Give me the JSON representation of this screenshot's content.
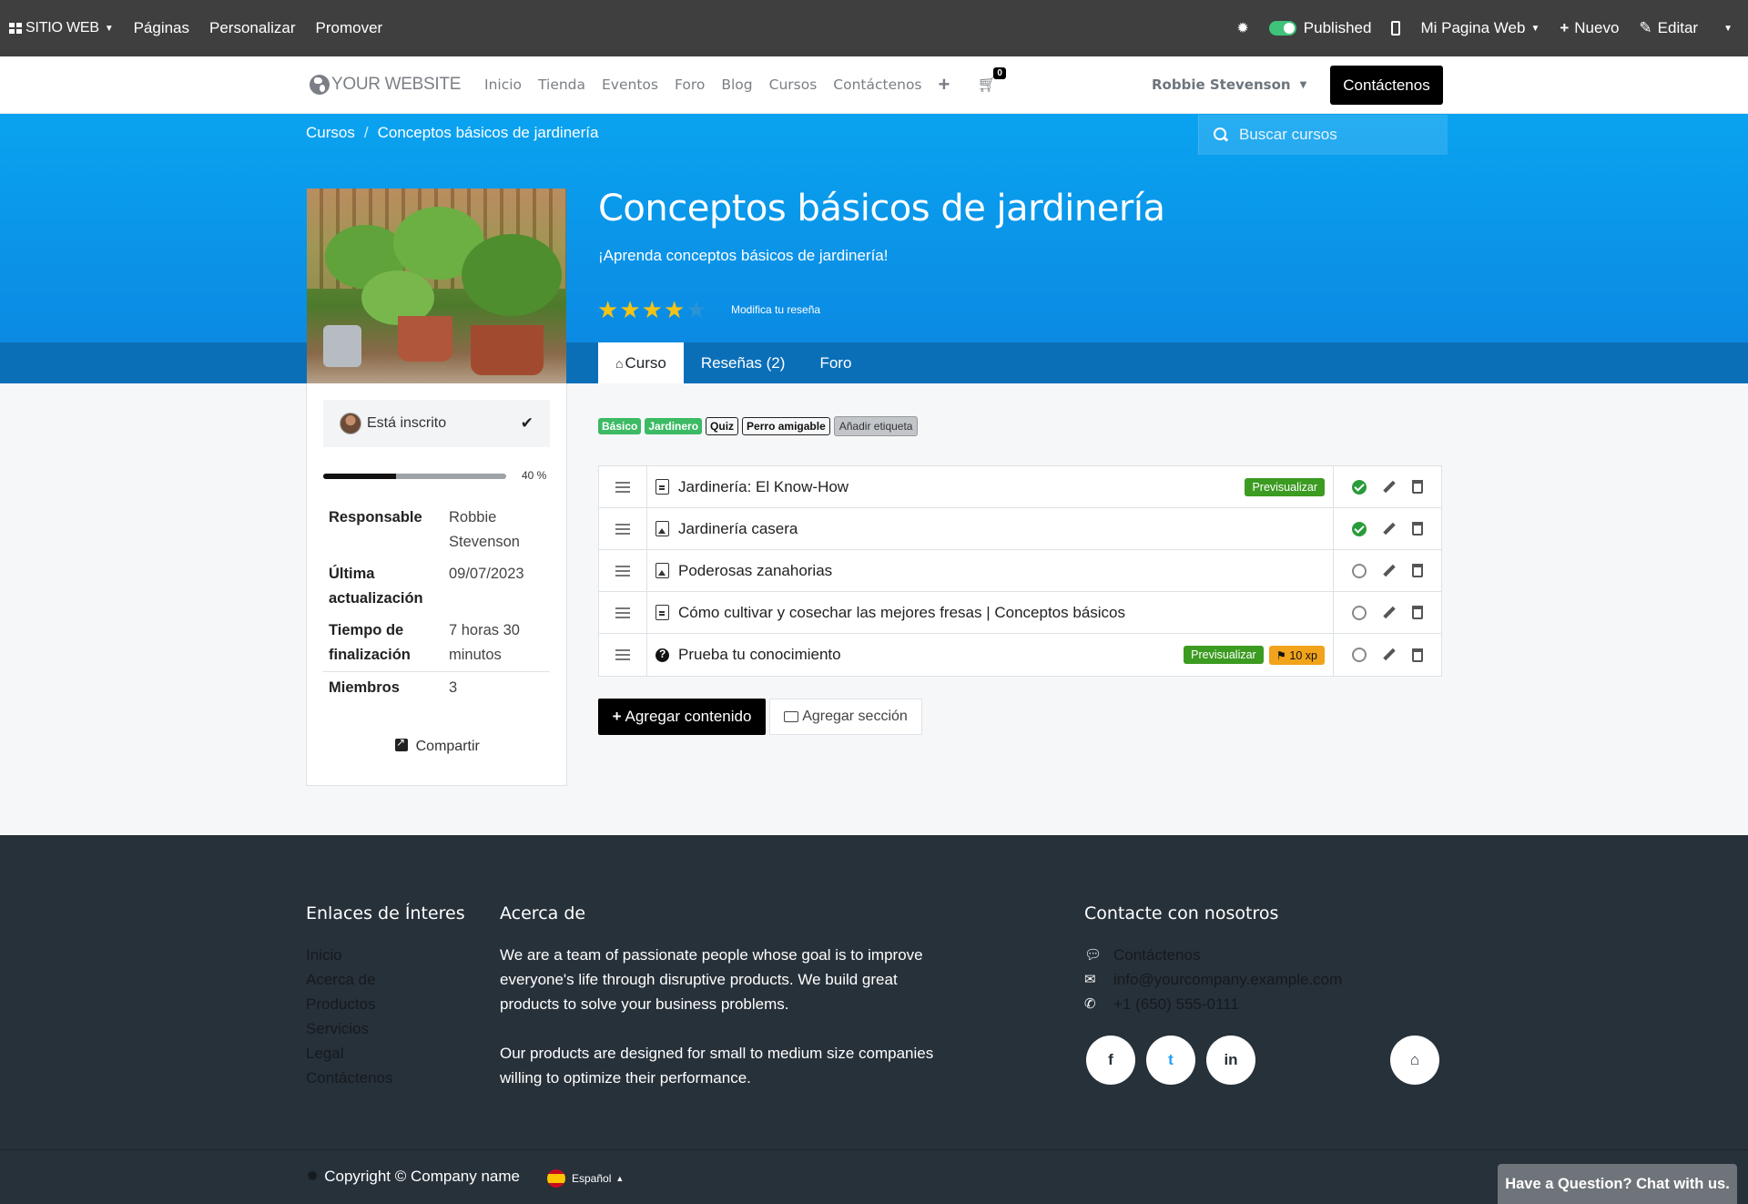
{
  "admin": {
    "brand": "SITIO WEB",
    "menu": [
      "Páginas",
      "Personalizar",
      "Promover"
    ],
    "published_label": "Published",
    "site_selector": "Mi Pagina Web",
    "new_label": "Nuevo",
    "edit_label": "Editar"
  },
  "site": {
    "logo_text": "YOUR WEBSITE",
    "nav": [
      "Inicio",
      "Tienda",
      "Eventos",
      "Foro",
      "Blog",
      "Cursos",
      "Contáctenos"
    ],
    "cart_count": "0",
    "user_name": "Robbie Stevenson",
    "cta_label": "Contáctenos"
  },
  "breadcrumb": {
    "root": "Cursos",
    "separator": "/",
    "current": "Conceptos básicos de jardinería"
  },
  "search": {
    "placeholder": "Buscar cursos"
  },
  "course": {
    "title": "Conceptos básicos de jardinería",
    "subtitle": "¡Aprenda conceptos básicos de jardinería!",
    "rating": 4,
    "rating_max": 5,
    "review_link": "Modifica tu reseña",
    "tabs": [
      "Curso",
      "Reseñas (2)",
      "Foro"
    ]
  },
  "sidebar": {
    "enrolled_label": "Está inscrito",
    "progress_value": 40,
    "progress_label": "40 %",
    "meta": [
      {
        "key": "Responsable",
        "value": "Robbie Stevenson"
      },
      {
        "key": "Última actualización",
        "value": "09/07/2023"
      },
      {
        "key": "Tiempo de finalización",
        "value": "7 horas 30 minutos"
      },
      {
        "key": "Miembros",
        "value": "3"
      }
    ],
    "share_label": "Compartir"
  },
  "tags": {
    "items": [
      "Básico",
      "Jardinero",
      "Quiz",
      "Perro amigable"
    ],
    "add_label": "Añadir etiqueta"
  },
  "contents": [
    {
      "title": "Jardinería: El Know-How",
      "icon": "document-icon",
      "preview": "Previsualizar",
      "xp": "",
      "completed": true
    },
    {
      "title": "Jardinería casera",
      "icon": "image-icon",
      "preview": "",
      "xp": "",
      "completed": true
    },
    {
      "title": "Poderosas zanahorias",
      "icon": "image-icon",
      "preview": "",
      "xp": "",
      "completed": false
    },
    {
      "title": "Cómo cultivar y cosechar las mejores fresas | Conceptos básicos",
      "icon": "document-icon",
      "preview": "",
      "xp": "",
      "completed": false
    },
    {
      "title": "Prueba tu conocimiento",
      "icon": "quiz-icon",
      "preview": "Previsualizar",
      "xp": "10 xp",
      "completed": false
    }
  ],
  "actions": {
    "add_content": "Agregar contenido",
    "add_section": "Agregar sección"
  },
  "footer": {
    "links_title": "Enlaces de Ínteres",
    "links": [
      "Inicio",
      "Acerca de",
      "Productos",
      "Servicios",
      "Legal",
      "Contáctenos"
    ],
    "about_title": "Acerca de",
    "about_p1": "We are a team of passionate people whose goal is to improve everyone's life through disruptive products. We build great products to solve your business problems.",
    "about_p2": "Our products are designed for small to medium size companies willing to optimize their performance.",
    "contact_title": "Contacte con nosotros",
    "contact_link": "Contáctenos",
    "email": "info@yourcompany.example.com",
    "phone": "+1 (650) 555-0111",
    "social": [
      "f",
      "t",
      "in"
    ],
    "copyright": "Copyright © Company name",
    "language": "Español"
  },
  "chat": {
    "label": "Have a Question? Chat with us."
  },
  "colors": {
    "hero_blue": "#0b8ae3",
    "preview_green": "#3c9b21",
    "xp_orange": "#f1a31b",
    "tag_green": "#3cba64",
    "footer_bg": "#273139"
  }
}
